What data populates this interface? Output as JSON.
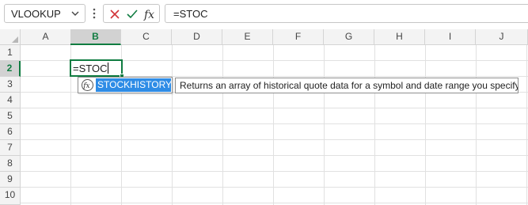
{
  "formula_bar": {
    "name_box": "VLOOKUP",
    "formula_text": "=STOC",
    "fx_label": "fx",
    "icons": [
      "chevron-down-icon",
      "more-vertical-icon",
      "cancel-x-icon",
      "confirm-check-icon",
      "insert-function-icon"
    ]
  },
  "columns": [
    "A",
    "B",
    "C",
    "D",
    "E",
    "F",
    "G",
    "H",
    "I",
    "J"
  ],
  "rows": [
    "1",
    "2",
    "3",
    "4",
    "5",
    "6",
    "7",
    "8",
    "9",
    "10"
  ],
  "selected": {
    "column": "B",
    "row": "2"
  },
  "active_cell": {
    "address": "B2",
    "value": "=STOC"
  },
  "autocomplete": {
    "items": [
      {
        "label": "STOCKHISTORY",
        "icon": "function-icon",
        "selected": true
      }
    ],
    "tooltip": "Returns an array of historical quote data for a symbol and date range you specify"
  },
  "colors": {
    "accent_green": "#107c41",
    "selection_blue": "#2e8ce6",
    "cancel_red": "#d13438",
    "confirm_green": "#107c41"
  }
}
